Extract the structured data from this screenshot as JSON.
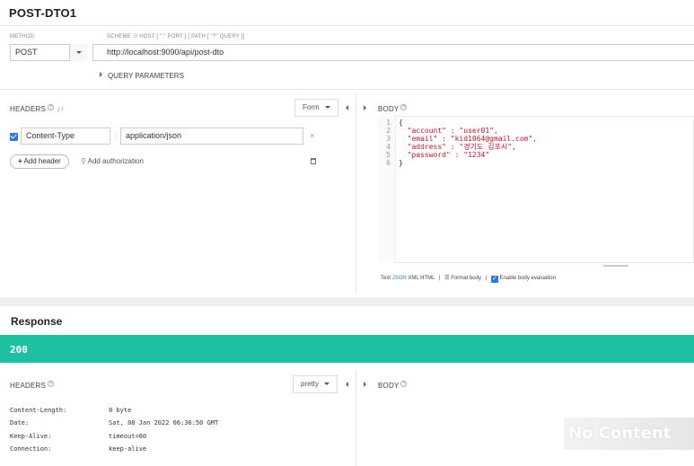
{
  "request": {
    "title": "POST-DTO1",
    "method_label": "METHOD",
    "url_label": "SCHEME :// HOST [ \":\" PORT ] [ PATH [ \"?\" QUERY ]]",
    "method": "POST",
    "url": "http://localhost:9090/api/post-dto",
    "query_parameters": "QUERY PARAMETERS"
  },
  "headers_panel": {
    "label": "HEADERS",
    "help": "?",
    "sort_icon": "sort-icon",
    "mode_dropdown": "Form",
    "rows": [
      {
        "enabled": true,
        "name": "Content-Type",
        "separator": ":",
        "value": "application/json"
      }
    ],
    "add_header": "Add header",
    "add_authorization": "Add authorization"
  },
  "body_panel": {
    "label": "BODY",
    "help": "?",
    "line_numbers": [
      "1",
      "2",
      "3",
      "4",
      "5",
      "6"
    ],
    "code_lines": [
      "{",
      "  \"account\" : \"user01\",",
      "  \"email\" : \"kid1064@gmail.com\",",
      "  \"address\" : \"경기도 김포시\",",
      "  \"password\" : \"1234\"",
      "}"
    ],
    "footer": {
      "text": "Text",
      "json": "JSON",
      "xml": "XML",
      "html": "HTML",
      "sep": "|",
      "format_body": "Format body",
      "enable_eval": "Enable body evaluation"
    }
  },
  "response": {
    "title": "Response",
    "status": "200",
    "status_color": "#1ec0a2",
    "headers_label": "HEADERS",
    "help": "?",
    "format_dropdown": "pretty",
    "body_label": "BODY",
    "headers": [
      {
        "name": "Content-Length:",
        "value": "0 byte"
      },
      {
        "name": "Date:",
        "value": "Sat, 08 Jan 2022 06:36:50 GMT"
      },
      {
        "name": "Keep-Alive:",
        "value": "timeout=60"
      },
      {
        "name": "Connection:",
        "value": "keep-alive"
      }
    ],
    "no_content": "No Content"
  }
}
